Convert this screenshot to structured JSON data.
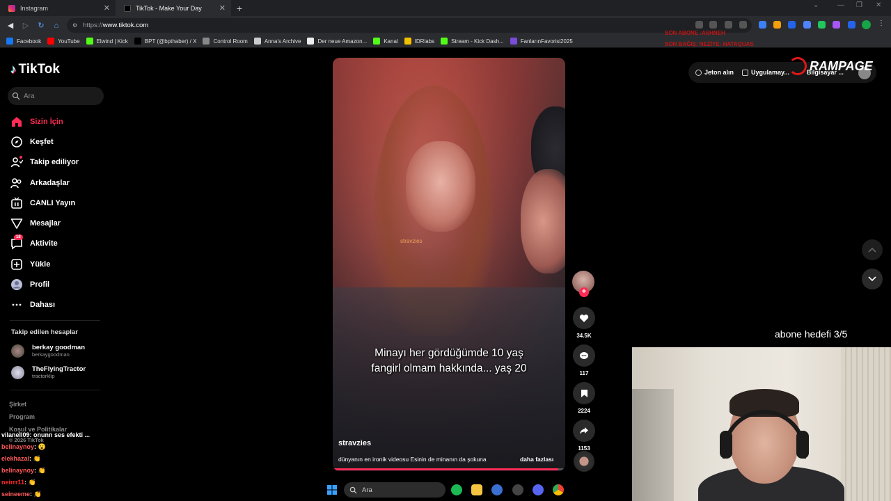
{
  "browser": {
    "tabs": [
      {
        "title": "Instagram",
        "color": "#e1306c",
        "active": false
      },
      {
        "title": "TikTok - Make Your Day",
        "color": "#000000",
        "active": true
      }
    ],
    "new_tab": "+",
    "url_scheme": "https://",
    "url_host": "www.tiktok.com",
    "bookmarks": [
      {
        "label": "Facebook",
        "color": "#1877f2"
      },
      {
        "label": "YouTube",
        "color": "#ff0000"
      },
      {
        "label": "Elwind | Kick",
        "color": "#53fc18"
      },
      {
        "label": "BPT (@bpthaber) / X",
        "color": "#000000"
      },
      {
        "label": "Control Room",
        "color": "#888888"
      },
      {
        "label": "Anna's Archive",
        "color": "#cccccc"
      },
      {
        "label": "Der neue Amazon...",
        "color": "#eeeeee"
      },
      {
        "label": "Kanal",
        "color": "#53fc18"
      },
      {
        "label": "IDRlabs",
        "color": "#f2c200"
      },
      {
        "label": "Stream - Kick Dash...",
        "color": "#53fc18"
      },
      {
        "label": "FanlarınFavorisi2025",
        "color": "#7a4bd6"
      }
    ]
  },
  "sidebar": {
    "logo": "TikTok",
    "search_placeholder": "Ara",
    "nav": [
      {
        "label": "Sizin İçin",
        "icon": "home-icon",
        "active": true
      },
      {
        "label": "Keşfet",
        "icon": "compass-icon"
      },
      {
        "label": "Takip ediliyor",
        "icon": "following-icon"
      },
      {
        "label": "Arkadaşlar",
        "icon": "friends-icon"
      },
      {
        "label": "CANLI Yayın",
        "icon": "live-icon"
      },
      {
        "label": "Mesajlar",
        "icon": "messages-icon"
      },
      {
        "label": "Aktivite",
        "icon": "activity-icon",
        "badge": "18"
      },
      {
        "label": "Yükle",
        "icon": "upload-icon"
      },
      {
        "label": "Profil",
        "icon": "profile-icon"
      },
      {
        "label": "Dahası",
        "icon": "more-icon"
      }
    ],
    "following_title": "Takip edilen hesaplar",
    "following": [
      {
        "name": "berkay goodman",
        "handle": "berkaygoodman"
      },
      {
        "name": "TheFlyingTractor",
        "handle": "tractorklip"
      }
    ],
    "footer": [
      "Şirket",
      "Program",
      "Koşul ve Politikalar",
      "© 2026 TikTok"
    ]
  },
  "chat": [
    {
      "user": "vilanell09",
      "msg": ": onunn ses efekti ...",
      "color": "#ffffff"
    },
    {
      "user": "belinaynoy",
      "msg": ": 😮",
      "color": "#ff5a5a"
    },
    {
      "user": "elekhazal",
      "msg": ": 👏",
      "color": "#ff5a5a"
    },
    {
      "user": "belinaynoy",
      "msg": ": 👏",
      "color": "#ff5a5a"
    },
    {
      "user": "neirrr11",
      "msg": ": 👏",
      "color": "#ff2a2a"
    },
    {
      "user": "seineeme",
      "msg": ": 👏",
      "color": "#ff5a5a"
    }
  ],
  "video": {
    "watermark": "stravzies",
    "caption": "Minayı her gördüğümde 10 yaş fangirl olmam hakkında... yaş 20",
    "author": "stravzies",
    "description": "dünyanın en ironik videosu Esinin de minanın da şokuna",
    "more_label": "daha fazlası",
    "progress": 0.97
  },
  "actions": {
    "likes": "34.5K",
    "comments": "117",
    "saves": "2224",
    "shares": "1153"
  },
  "topbar": {
    "coins": "Jeton alın",
    "app": "Uygulamay...",
    "pc": "Bilgisayar ..."
  },
  "overlay": {
    "brand": "RAMPAGE",
    "red_line1": "SON ABONE :ASHNEH",
    "red_line2": "SON BAĞIŞ: NEZİYE- HATAQUAS",
    "goal": "abone hedefi 3/5"
  },
  "taskbar": {
    "search_placeholder": "Ara"
  }
}
